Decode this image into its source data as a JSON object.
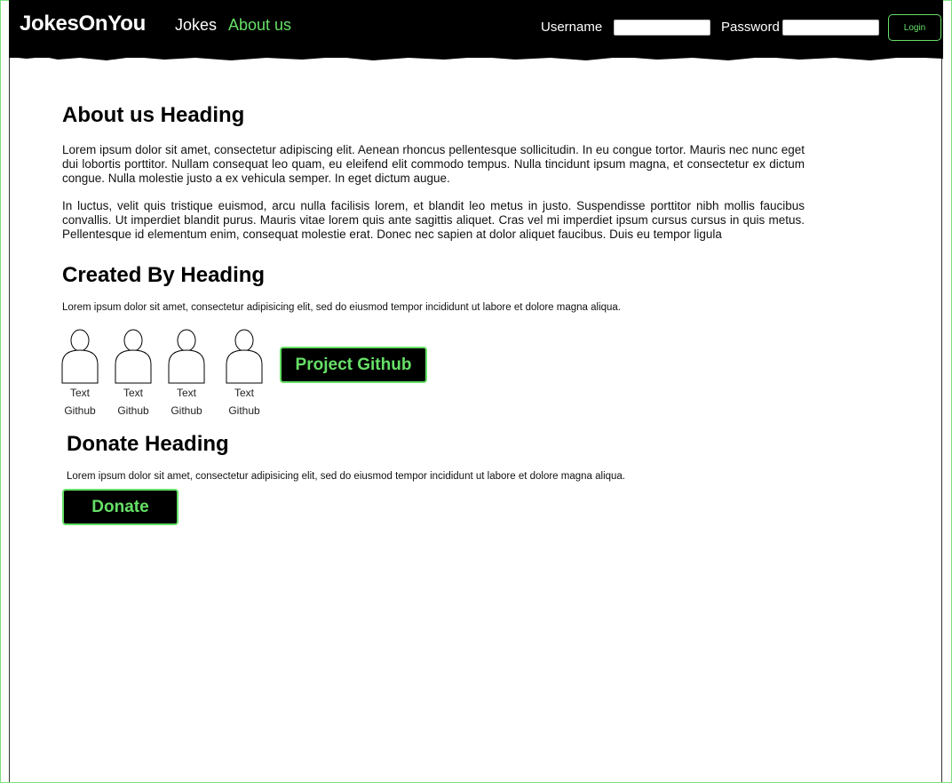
{
  "navbar": {
    "brand": "JokesOnYou",
    "links": [
      {
        "label": "Jokes",
        "active": false
      },
      {
        "label": "About us",
        "active": true
      }
    ],
    "username_label": "Username",
    "password_label": "Password",
    "username_value": "",
    "password_value": "",
    "login_label": "Login"
  },
  "about": {
    "heading": "About us Heading",
    "paragraphs": [
      "Lorem ipsum dolor sit amet, consectetur adipiscing elit. Aenean rhoncus pellentesque sollicitudin. In eu congue tortor. Mauris nec nunc eget dui lobortis porttitor. Nullam consequat leo quam, eu eleifend elit commodo tempus. Nulla tincidunt ipsum magna, et consectetur ex dictum congue. Nulla molestie justo a ex vehicula semper. In eget dictum augue.",
      "In luctus, velit quis tristique euismod, arcu nulla facilisis lorem, et blandit leo metus in justo. Suspendisse porttitor nibh mollis faucibus convallis. Ut imperdiet blandit purus. Mauris vitae lorem quis ante sagittis aliquet. Cras vel mi imperdiet ipsum cursus cursus in quis metus. Pellentesque id elementum enim, consequat molestie erat. Donec nec sapien at dolor aliquet faucibus. Duis eu tempor ligula"
    ]
  },
  "created_by": {
    "heading": "Created By Heading",
    "description": "Lorem ipsum dolor sit amet, consectetur adipisicing elit, sed do eiusmod tempor incididunt ut labore et dolore magna aliqua.",
    "members": [
      {
        "text": "Text",
        "github": "Github",
        "icon": "person-icon"
      },
      {
        "text": "Text",
        "github": "Github",
        "icon": "person-icon"
      },
      {
        "text": "Text",
        "github": "Github",
        "icon": "person-icon"
      },
      {
        "text": "Text",
        "github": "Github",
        "icon": "person-icon"
      }
    ],
    "project_button": "Project Github"
  },
  "donate": {
    "heading": "Donate Heading",
    "description": "Lorem ipsum dolor sit amet, consectetur adipisicing elit, sed do eiusmod tempor incididunt ut labore et dolore magna aliqua.",
    "button": "Donate"
  },
  "colors": {
    "navbar_bg": "#000000",
    "accent_green": "#66e066",
    "page_bg": "#ffffff"
  }
}
